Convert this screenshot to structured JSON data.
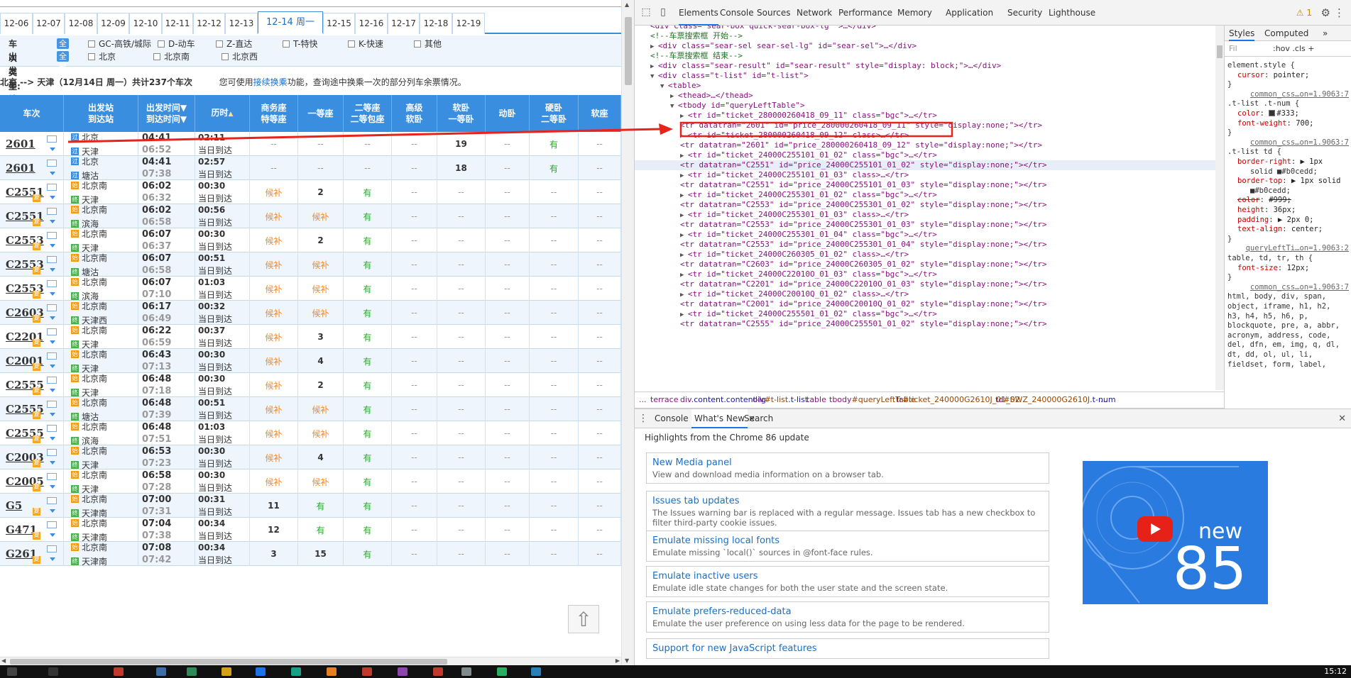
{
  "dates": [
    {
      "label": "12-06",
      "active": false
    },
    {
      "label": "12-07",
      "active": false
    },
    {
      "label": "12-08",
      "active": false
    },
    {
      "label": "12-09",
      "active": false
    },
    {
      "label": "12-10",
      "active": false
    },
    {
      "label": "12-11",
      "active": false
    },
    {
      "label": "12-12",
      "active": false
    },
    {
      "label": "12-13",
      "active": false
    },
    {
      "label": "12-14 周一",
      "active": true
    },
    {
      "label": "12-15",
      "active": false
    },
    {
      "label": "12-16",
      "active": false
    },
    {
      "label": "12-17",
      "active": false
    },
    {
      "label": "12-18",
      "active": false
    },
    {
      "label": "12-19",
      "active": false
    }
  ],
  "filters": {
    "type_label": "车次类型:",
    "all": "全部",
    "types": [
      "GC-高铁/城际",
      "D-动车",
      "Z-直达",
      "T-特快",
      "K-快速",
      "其他"
    ],
    "station_label": "出发车站:",
    "stations": [
      "北京",
      "北京南",
      "北京西"
    ]
  },
  "route": {
    "summary": "北京 --> 天津（12月14日 周一）共计237个车次",
    "hint_pre": "您可使用",
    "hint_link": "接续换乘",
    "hint_post": "功能，查询途中换乘一次的部分列车余票情况。"
  },
  "headers": [
    {
      "l1": "车次",
      "l2": "",
      "sort": false
    },
    {
      "l1": "出发站",
      "l2": "到达站",
      "sort": false
    },
    {
      "l1": "出发时间▼",
      "l2": "到达时间▼",
      "sort": false
    },
    {
      "l1": "历时",
      "l2": "",
      "sort": true
    },
    {
      "l1": "商务座",
      "l2": "特等座",
      "sort": false
    },
    {
      "l1": "一等座",
      "l2": "",
      "sort": false
    },
    {
      "l1": "二等座",
      "l2": "二等包座",
      "sort": false
    },
    {
      "l1": "高级",
      "l2": "软卧",
      "sort": false
    },
    {
      "l1": "软卧",
      "l2": "一等卧",
      "sort": false
    },
    {
      "l1": "动卧",
      "l2": "",
      "sort": false
    },
    {
      "l1": "硬卧",
      "l2": "二等卧",
      "sort": false
    },
    {
      "l1": "软座",
      "l2": ""
    }
  ],
  "sort_mark": "▲",
  "xia": "复",
  "rows": [
    {
      "train": "2601",
      "xia": false,
      "from": "北京",
      "to": "天津",
      "fi": "p",
      "ti": "p",
      "dep": "04:41",
      "arr": "06:52",
      "dur": "02:11",
      "day": "当日到达",
      "sw": "--",
      "yd": "--",
      "ed": "--",
      "gr": "--",
      "rw": "19",
      "dw": "--",
      "yw": "有",
      "rz": "--"
    },
    {
      "train": "2601",
      "xia": false,
      "from": "北京",
      "to": "塘沽",
      "fi": "p",
      "ti": "p",
      "dep": "04:41",
      "arr": "07:38",
      "dur": "02:57",
      "day": "当日到达",
      "sw": "--",
      "yd": "--",
      "ed": "--",
      "gr": "--",
      "rw": "18",
      "dw": "--",
      "yw": "有",
      "rz": "--"
    },
    {
      "train": "C2551",
      "xia": true,
      "from": "北京南",
      "to": "天津",
      "fi": "s",
      "ti": "g",
      "dep": "06:02",
      "arr": "06:32",
      "dur": "00:30",
      "day": "当日到达",
      "sw": "候补",
      "yd": "2",
      "ed": "有",
      "gr": "--",
      "rw": "--",
      "dw": "--",
      "yw": "--",
      "rz": "--"
    },
    {
      "train": "C2551",
      "xia": true,
      "from": "北京南",
      "to": "滨海",
      "fi": "s",
      "ti": "g",
      "dep": "06:02",
      "arr": "06:58",
      "dur": "00:56",
      "day": "当日到达",
      "sw": "候补",
      "yd": "候补",
      "ed": "有",
      "gr": "--",
      "rw": "--",
      "dw": "--",
      "yw": "--",
      "rz": "--"
    },
    {
      "train": "C2553",
      "xia": true,
      "from": "北京南",
      "to": "天津",
      "fi": "s",
      "ti": "g",
      "dep": "06:07",
      "arr": "06:37",
      "dur": "00:30",
      "day": "当日到达",
      "sw": "候补",
      "yd": "2",
      "ed": "有",
      "gr": "--",
      "rw": "--",
      "dw": "--",
      "yw": "--",
      "rz": "--"
    },
    {
      "train": "C2553",
      "xia": true,
      "from": "北京南",
      "to": "塘沽",
      "fi": "s",
      "ti": "g",
      "dep": "06:07",
      "arr": "06:58",
      "dur": "00:51",
      "day": "当日到达",
      "sw": "候补",
      "yd": "候补",
      "ed": "有",
      "gr": "--",
      "rw": "--",
      "dw": "--",
      "yw": "--",
      "rz": "--"
    },
    {
      "train": "C2553",
      "xia": true,
      "from": "北京南",
      "to": "滨海",
      "fi": "s",
      "ti": "g",
      "dep": "06:07",
      "arr": "07:10",
      "dur": "01:03",
      "day": "当日到达",
      "sw": "候补",
      "yd": "候补",
      "ed": "有",
      "gr": "--",
      "rw": "--",
      "dw": "--",
      "yw": "--",
      "rz": "--"
    },
    {
      "train": "C2603",
      "xia": true,
      "from": "北京南",
      "to": "天津西",
      "fi": "s",
      "ti": "g",
      "dep": "06:17",
      "arr": "06:49",
      "dur": "00:32",
      "day": "当日到达",
      "sw": "候补",
      "yd": "候补",
      "ed": "有",
      "gr": "--",
      "rw": "--",
      "dw": "--",
      "yw": "--",
      "rz": "--"
    },
    {
      "train": "C2201",
      "xia": true,
      "from": "北京南",
      "to": "天津",
      "fi": "s",
      "ti": "g",
      "dep": "06:22",
      "arr": "06:59",
      "dur": "00:37",
      "day": "当日到达",
      "sw": "候补",
      "yd": "3",
      "ed": "有",
      "gr": "--",
      "rw": "--",
      "dw": "--",
      "yw": "--",
      "rz": "--"
    },
    {
      "train": "C2001",
      "xia": true,
      "from": "北京南",
      "to": "天津",
      "fi": "s",
      "ti": "g",
      "dep": "06:43",
      "arr": "07:13",
      "dur": "00:30",
      "day": "当日到达",
      "sw": "候补",
      "yd": "4",
      "ed": "有",
      "gr": "--",
      "rw": "--",
      "dw": "--",
      "yw": "--",
      "rz": "--"
    },
    {
      "train": "C2555",
      "xia": true,
      "from": "北京南",
      "to": "天津",
      "fi": "s",
      "ti": "g",
      "dep": "06:48",
      "arr": "07:18",
      "dur": "00:30",
      "day": "当日到达",
      "sw": "候补",
      "yd": "2",
      "ed": "有",
      "gr": "--",
      "rw": "--",
      "dw": "--",
      "yw": "--",
      "rz": "--"
    },
    {
      "train": "C2555",
      "xia": true,
      "from": "北京南",
      "to": "塘沽",
      "fi": "s",
      "ti": "g",
      "dep": "06:48",
      "arr": "07:39",
      "dur": "00:51",
      "day": "当日到达",
      "sw": "候补",
      "yd": "候补",
      "ed": "有",
      "gr": "--",
      "rw": "--",
      "dw": "--",
      "yw": "--",
      "rz": "--"
    },
    {
      "train": "C2555",
      "xia": true,
      "from": "北京南",
      "to": "滨海",
      "fi": "s",
      "ti": "g",
      "dep": "06:48",
      "arr": "07:51",
      "dur": "01:03",
      "day": "当日到达",
      "sw": "候补",
      "yd": "候补",
      "ed": "有",
      "gr": "--",
      "rw": "--",
      "dw": "--",
      "yw": "--",
      "rz": "--"
    },
    {
      "train": "C2003",
      "xia": true,
      "from": "北京南",
      "to": "天津",
      "fi": "s",
      "ti": "g",
      "dep": "06:53",
      "arr": "07:23",
      "dur": "00:30",
      "day": "当日到达",
      "sw": "候补",
      "yd": "4",
      "ed": "有",
      "gr": "--",
      "rw": "--",
      "dw": "--",
      "yw": "--",
      "rz": "--"
    },
    {
      "train": "C2005",
      "xia": true,
      "from": "北京南",
      "to": "天津",
      "fi": "s",
      "ti": "g",
      "dep": "06:58",
      "arr": "07:28",
      "dur": "00:30",
      "day": "当日到达",
      "sw": "候补",
      "yd": "候补",
      "ed": "有",
      "gr": "--",
      "rw": "--",
      "dw": "--",
      "yw": "--",
      "rz": "--"
    },
    {
      "train": "G5",
      "xia": true,
      "from": "北京南",
      "to": "天津南",
      "fi": "s",
      "ti": "g",
      "dep": "07:00",
      "arr": "07:31",
      "dur": "00:31",
      "day": "当日到达",
      "sw": "11",
      "yd": "有",
      "ed": "有",
      "gr": "--",
      "rw": "--",
      "dw": "--",
      "yw": "--",
      "rz": "--"
    },
    {
      "train": "G471",
      "xia": true,
      "from": "北京南",
      "to": "天津南",
      "fi": "s",
      "ti": "g",
      "dep": "07:04",
      "arr": "07:38",
      "dur": "00:34",
      "day": "当日到达",
      "sw": "12",
      "yd": "有",
      "ed": "有",
      "gr": "--",
      "rw": "--",
      "dw": "--",
      "yw": "--",
      "rz": "--"
    },
    {
      "train": "G261",
      "xia": true,
      "from": "北京南",
      "to": "天津南",
      "fi": "s",
      "ti": "g",
      "dep": "07:08",
      "arr": "07:42",
      "dur": "00:34",
      "day": "当日到达",
      "sw": "3",
      "yd": "15",
      "ed": "有",
      "gr": "--",
      "rw": "--",
      "dw": "--",
      "yw": "--",
      "rz": "--"
    }
  ],
  "backtop": "⇧",
  "devtools": {
    "tabs": [
      "Elements",
      "Console",
      "Sources",
      "Network",
      "Performance",
      "Memory",
      "Application",
      "Security",
      "Lighthouse"
    ],
    "warn": "⚠ 1",
    "lines": [
      {
        "ind": 1,
        "tri": "",
        "html": "<div class=\"sear-box quick-sear-box-lg\" >…</div>",
        "kind": "partial",
        "sel": false
      },
      {
        "ind": 1,
        "tri": "",
        "html": "<!--车票搜索框 开始-->",
        "kind": "comment",
        "sel": false
      },
      {
        "ind": 1,
        "tri": "▶",
        "html": "<div class=\"sear-sel sear-sel-lg\" id=\"sear-sel\">…</div>",
        "kind": "tag",
        "sel": false
      },
      {
        "ind": 1,
        "tri": "",
        "html": "<!--车票搜索框 结束-->",
        "kind": "comment",
        "sel": false
      },
      {
        "ind": 1,
        "tri": "▶",
        "html": "<div class=\"sear-result\" id=\"sear-result\" style=\"display: block;\">…</div>",
        "kind": "tag",
        "sel": false
      },
      {
        "ind": 1,
        "tri": "▼",
        "html": "<div class=\"t-list\" id=\"t-list\">",
        "kind": "tag",
        "sel": false
      },
      {
        "ind": 2,
        "tri": "▼",
        "html": "<table>",
        "kind": "tag",
        "sel": false
      },
      {
        "ind": 3,
        "tri": "▶",
        "html": "<thead>…</thead>",
        "kind": "tag",
        "sel": false
      },
      {
        "ind": 3,
        "tri": "▼",
        "html": "<tbody id=\"queryLeftTable\">",
        "kind": "tag",
        "sel": false
      },
      {
        "ind": 4,
        "tri": "▶",
        "html": "<tr id=\"ticket_280000260418_09_11\" class=\"bgc\">…</tr>",
        "kind": "tag",
        "sel": false
      },
      {
        "ind": 4,
        "tri": "",
        "html": "<tr datatran=\"2601\" id=\"price_280000260418_09_11\" style=\"display:none;\"></tr>",
        "kind": "tag",
        "sel": false
      },
      {
        "ind": 4,
        "tri": "▶",
        "html": "<tr id=\"ticket_280000260418_09_12\" class>…</tr>",
        "kind": "tag",
        "sel": false
      },
      {
        "ind": 4,
        "tri": "",
        "html": "<tr datatran=\"2601\" id=\"price_280000260418_09_12\" style=\"display:none;\"></tr>",
        "kind": "tag",
        "sel": false
      },
      {
        "ind": 4,
        "tri": "▶",
        "html": "<tr id=\"ticket_24000C255101_01_02\" class=\"bgc\">…</tr>",
        "kind": "tag",
        "sel": false
      },
      {
        "ind": 4,
        "tri": "",
        "html": "<tr datatran=\"C2551\" id=\"price_24000C255101_01_02\" style=\"display:none;\"></tr>",
        "kind": "tag",
        "sel": true
      },
      {
        "ind": 4,
        "tri": "▶",
        "html": "<tr id=\"ticket_24000C255101_01_03\" class>…</tr>",
        "kind": "tag",
        "sel": false
      },
      {
        "ind": 4,
        "tri": "",
        "html": "<tr datatran=\"C2551\" id=\"price_24000C255101_01_03\" style=\"display:none;\"></tr>",
        "kind": "tag",
        "sel": false
      },
      {
        "ind": 4,
        "tri": "▶",
        "html": "<tr id=\"ticket_24000C255301_01_02\" class=\"bgc\">…</tr>",
        "kind": "tag",
        "sel": false
      },
      {
        "ind": 4,
        "tri": "",
        "html": "<tr datatran=\"C2553\" id=\"price_24000C255301_01_02\" style=\"display:none;\"></tr>",
        "kind": "tag",
        "sel": false
      },
      {
        "ind": 4,
        "tri": "▶",
        "html": "<tr id=\"ticket_24000C255301_01_03\" class>…</tr>",
        "kind": "tag",
        "sel": false
      },
      {
        "ind": 4,
        "tri": "",
        "html": "<tr datatran=\"C2553\" id=\"price_24000C255301_01_03\" style=\"display:none;\"></tr>",
        "kind": "tag",
        "sel": false
      },
      {
        "ind": 4,
        "tri": "▶",
        "html": "<tr id=\"ticket_24000C255301_01_04\" class=\"bgc\">…</tr>",
        "kind": "tag",
        "sel": false
      },
      {
        "ind": 4,
        "tri": "",
        "html": "<tr datatran=\"C2553\" id=\"price_24000C255301_01_04\" style=\"display:none;\"></tr>",
        "kind": "tag",
        "sel": false
      },
      {
        "ind": 4,
        "tri": "▶",
        "html": "<tr id=\"ticket_24000C260305_01_02\" class>…</tr>",
        "kind": "tag",
        "sel": false
      },
      {
        "ind": 4,
        "tri": "",
        "html": "<tr datatran=\"C2603\" id=\"price_24000C260305_01_02\" style=\"display:none;\"></tr>",
        "kind": "tag",
        "sel": false
      },
      {
        "ind": 4,
        "tri": "▶",
        "html": "<tr id=\"ticket_24000C22010O_01_03\" class=\"bgc\">…</tr>",
        "kind": "tag",
        "sel": false
      },
      {
        "ind": 4,
        "tri": "",
        "html": "<tr datatran=\"C2201\" id=\"price_24000C22010O_01_03\" style=\"display:none;\"></tr>",
        "kind": "tag",
        "sel": false
      },
      {
        "ind": 4,
        "tri": "▶",
        "html": "<tr id=\"ticket_24000C20010Q_01_02\" class>…</tr>",
        "kind": "tag",
        "sel": false
      },
      {
        "ind": 4,
        "tri": "",
        "html": "<tr datatran=\"C2001\" id=\"price_24000C20010Q_01_02\" style=\"display:none;\"></tr>",
        "kind": "tag",
        "sel": false
      },
      {
        "ind": 4,
        "tri": "▶",
        "html": "<tr id=\"ticket_24000C255501_01_02\" class=\"bgc\">…</tr>",
        "kind": "tag",
        "sel": false
      },
      {
        "ind": 4,
        "tri": "",
        "html": "<tr datatran=\"C2555\" id=\"price_24000C255501_01_02\" style=\"display:none;\"></tr>",
        "kind": "tag",
        "sel": false
      }
    ],
    "crumbs": [
      {
        "t": "...",
        "i": "",
        "c": ""
      },
      {
        "t": "terrace",
        "i": "",
        "c": ""
      },
      {
        "t": "div",
        "i": "",
        "c": ".content.content-lg"
      },
      {
        "t": "div",
        "i": "#t-list",
        "c": ".t-list"
      },
      {
        "t": "table",
        "i": "",
        "c": ""
      },
      {
        "t": "tbody",
        "i": "#queryLeftTable",
        "c": ""
      },
      {
        "t": "tr",
        "i": "#ticket_240000G2610J_01_02",
        "c": ""
      },
      {
        "t": "td",
        "i": "#SWZ_240000G2610J",
        "c": ".t-num"
      },
      {
        "t": "...",
        "i": "",
        "c": ""
      }
    ],
    "styles_tabs": [
      "Styles",
      "Computed",
      "»"
    ],
    "filter_placeholder": "Fil",
    "filter_btns": ":hov  .cls  +",
    "style_lines": [
      {
        "k": "sel",
        "t": "element.style {"
      },
      {
        "k": "prop",
        "p": "cursor",
        "v": "pointer;"
      },
      {
        "k": "close",
        "t": "}"
      },
      {
        "k": "src",
        "t": "common_css…on=1.9063:7"
      },
      {
        "k": "sel",
        "t": ".t-list .t-num {"
      },
      {
        "k": "prop",
        "p": "color",
        "v": "#333;",
        "sw": "#333333"
      },
      {
        "k": "prop",
        "p": "font-weight",
        "v": "700;"
      },
      {
        "k": "close",
        "t": "}"
      },
      {
        "k": "src",
        "t": "common_css…on=1.9063:7"
      },
      {
        "k": "sel",
        "t": ".t-list td {"
      },
      {
        "k": "prop",
        "p": "border-right",
        "v": "▶ 1px"
      },
      {
        "k": "cont",
        "t": "solid ■#b0cedd;"
      },
      {
        "k": "prop",
        "p": "border-top",
        "v": "▶ 1px solid"
      },
      {
        "k": "cont",
        "t": "■#b0cedd;"
      },
      {
        "k": "strike",
        "p": "color",
        "v": "#999;"
      },
      {
        "k": "prop",
        "p": "height",
        "v": "36px;"
      },
      {
        "k": "prop",
        "p": "padding",
        "v": "▶ 2px 0;"
      },
      {
        "k": "prop",
        "p": "text-align",
        "v": "center;"
      },
      {
        "k": "close",
        "t": "}"
      },
      {
        "k": "src",
        "t": "queryLeftTi…on=1.9063:2"
      },
      {
        "k": "sel",
        "t": "table, td, tr, th {"
      },
      {
        "k": "prop",
        "p": "font-size",
        "v": "12px;"
      },
      {
        "k": "close",
        "t": "}"
      },
      {
        "k": "src",
        "t": "common_css…on=1.9063:7"
      },
      {
        "k": "sel",
        "t": "html, body, div, span,"
      },
      {
        "k": "sel",
        "t": "object, iframe, h1, h2,"
      },
      {
        "k": "sel",
        "t": "h3, h4, h5, h6, p,"
      },
      {
        "k": "sel",
        "t": "blockquote, pre, a, abbr,"
      },
      {
        "k": "sel",
        "t": "acronym, address, code,"
      },
      {
        "k": "sel",
        "t": "del, dfn, em, img, q, dl,"
      },
      {
        "k": "sel",
        "t": "dt, dd, ol, ul, li,"
      },
      {
        "k": "sel",
        "t": "fieldset, form, label,"
      }
    ],
    "drawer_tabs": [
      "Console",
      "What's New",
      "Search"
    ],
    "drawer_close": "×",
    "highlights": "Highlights from the Chrome 86 update",
    "cards": [
      {
        "title": "New Media panel",
        "desc": "View and download media information on a browser tab."
      },
      {
        "title": "Issues tab updates",
        "desc": "The Issues warning bar is replaced with a regular message. Issues tab has a new checkbox to filter third-party cookie issues."
      },
      {
        "title": "Emulate missing local fonts",
        "desc": "Emulate missing `local()` sources in @font-face rules."
      },
      {
        "title": "Emulate inactive users",
        "desc": "Emulate idle state changes for both the user state and the screen state."
      },
      {
        "title": "Emulate prefers-reduced-data",
        "desc": "Emulate the user preference on using less data for the page to be rendered."
      },
      {
        "title": "Support for new JavaScript features",
        "desc": ""
      }
    ],
    "promo": {
      "new": "new",
      "num": "85"
    }
  },
  "clock": "15:12"
}
